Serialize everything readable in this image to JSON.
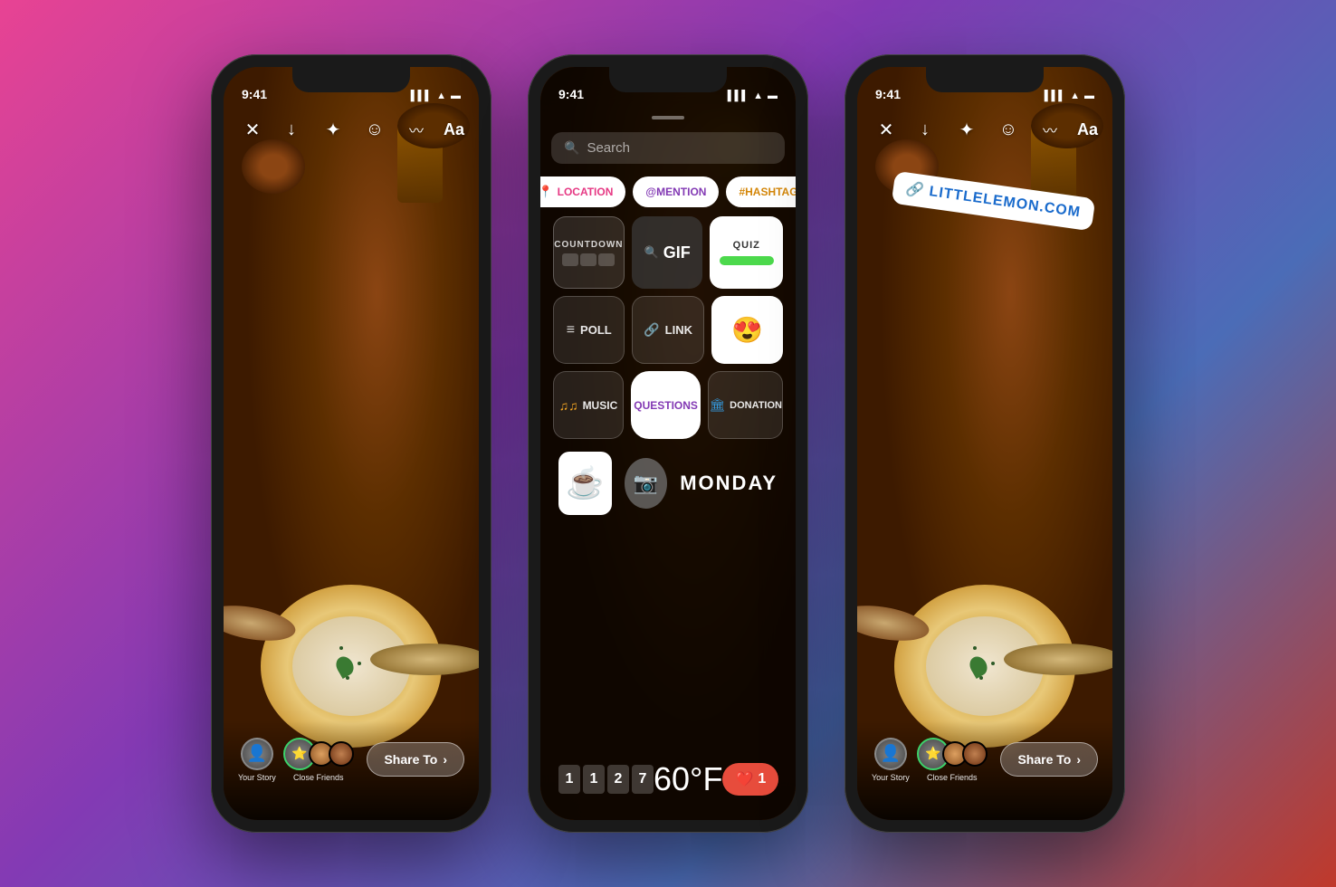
{
  "background": {
    "gradient_start": "#e84393",
    "gradient_mid": "#833ab4",
    "gradient_end": "#c0392b"
  },
  "phones": [
    {
      "id": "phone-left",
      "status": {
        "time": "9:41",
        "signal": "●●●",
        "wifi": "wifi",
        "battery": "battery"
      },
      "toolbar": {
        "close": "✕",
        "download": "↓",
        "move": "✦",
        "face": "☺",
        "wave": "〰",
        "text": "Aa"
      },
      "bottom": {
        "your_story_label": "Your Story",
        "close_friends_label": "Close Friends",
        "share_btn": "Share To"
      }
    },
    {
      "id": "phone-middle",
      "status": {
        "time": "9:41",
        "signal": "●●●",
        "wifi": "wifi",
        "battery": "battery"
      },
      "sticker_panel": {
        "search_placeholder": "Search",
        "stickers": [
          {
            "id": "location",
            "label": "LOCATION",
            "icon": "📍",
            "color": "#e63984"
          },
          {
            "id": "mention",
            "label": "@MENTION",
            "icon": "@",
            "color": "#833ab4"
          },
          {
            "id": "hashtag",
            "label": "#HASHTAG",
            "icon": "#",
            "color": "#d4870a"
          },
          {
            "id": "countdown",
            "label": "COUNTDOWN",
            "icon": "⏱"
          },
          {
            "id": "gif",
            "label": "GIF",
            "icon": "🔍"
          },
          {
            "id": "quiz",
            "label": "QUIZ",
            "icon": "✓"
          },
          {
            "id": "poll",
            "label": "POLL",
            "icon": "≡"
          },
          {
            "id": "link",
            "label": "LINK",
            "icon": "🔗"
          },
          {
            "id": "emoji_slider",
            "label": "😍",
            "icon": "😍"
          },
          {
            "id": "music",
            "label": "MUSIC",
            "icon": "♫"
          },
          {
            "id": "questions",
            "label": "QUESTIONS",
            "icon": "?"
          },
          {
            "id": "donation",
            "label": "DONATION",
            "icon": "🏛"
          }
        ],
        "bottom_row": [
          {
            "id": "mug_sticker",
            "emoji": "☕"
          },
          {
            "id": "camera",
            "icon": "📷"
          },
          {
            "id": "monday",
            "label": "MONDAY"
          }
        ],
        "temp": "60°F",
        "digits": [
          "1",
          "1",
          "2",
          "7"
        ],
        "likes": "1"
      }
    },
    {
      "id": "phone-right",
      "status": {
        "time": "9:41",
        "signal": "●●●",
        "wifi": "wifi",
        "battery": "battery"
      },
      "toolbar": {
        "close": "✕",
        "download": "↓",
        "move": "✦",
        "face": "☺",
        "wave": "〰",
        "text": "Aa"
      },
      "link_sticker": {
        "icon": "🔗",
        "text": "LITTLELEMON.COM"
      },
      "bottom": {
        "your_story_label": "Your Story",
        "close_friends_label": "Close Friends",
        "share_btn": "Share To"
      }
    }
  ]
}
